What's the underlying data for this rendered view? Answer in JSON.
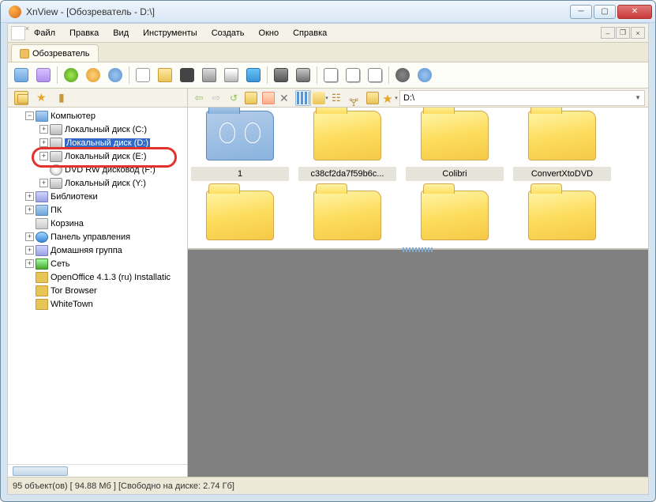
{
  "title": "XnView - [Обозреватель - D:\\]",
  "menu": {
    "file": "Файл",
    "edit": "Правка",
    "view": "Вид",
    "tools": "Инструменты",
    "create": "Создать",
    "window": "Окно",
    "help": "Справка"
  },
  "tab": {
    "label": "Обозреватель"
  },
  "address": {
    "path": "D:\\"
  },
  "tree": {
    "computer": "Компьютер",
    "drive_c": "Локальный диск (C:)",
    "drive_d": "Локальный диск (D:)",
    "drive_e": "Локальный диск (E:)",
    "drive_f": "DVD RW дисковод (F:)",
    "drive_y": "Локальный диск (Y:)",
    "libraries": "Библиотеки",
    "pc": "ПК",
    "trash": "Корзина",
    "control_panel": "Панель управления",
    "homegroup": "Домашняя группа",
    "network": "Сеть",
    "openoffice": "OpenOffice 4.1.3 (ru) Installatic",
    "tor": "Tor Browser",
    "whitetown": "WhiteTown"
  },
  "thumbs": [
    {
      "name": "1",
      "selected": true
    },
    {
      "name": "c38cf2da7f59b6c...",
      "selected": false
    },
    {
      "name": "Colibri",
      "selected": false
    },
    {
      "name": "ConvertXtoDVD",
      "selected": false
    },
    {
      "name": "",
      "selected": false
    },
    {
      "name": "",
      "selected": false
    },
    {
      "name": "",
      "selected": false
    },
    {
      "name": "",
      "selected": false
    }
  ],
  "status": "95 объект(ов) [ 94.88 Мб ] [Свободно на диске: 2.74 Гб]"
}
